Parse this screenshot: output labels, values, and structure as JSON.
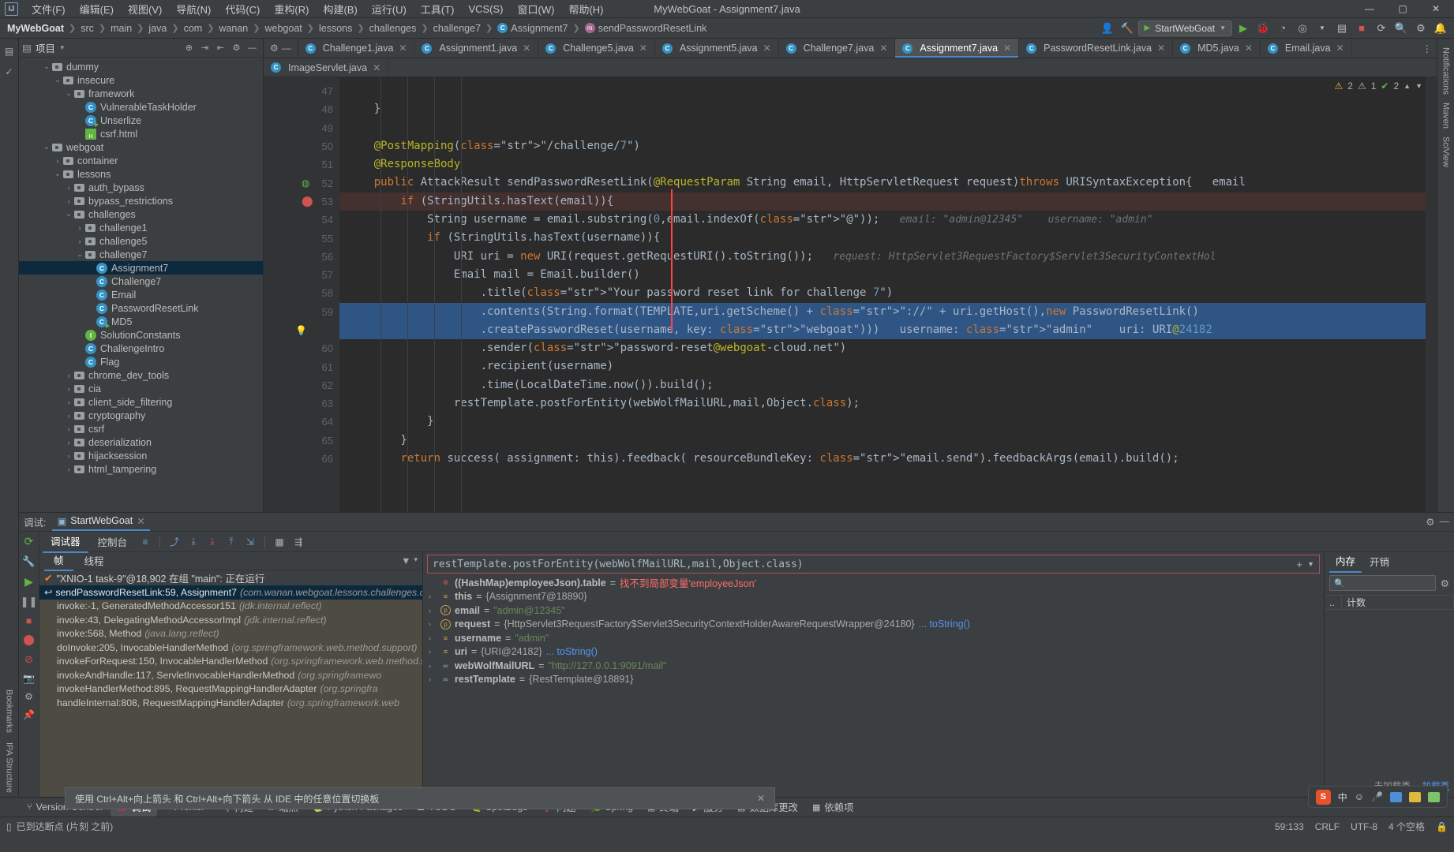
{
  "window": {
    "title": "MyWebGoat - Assignment7.java",
    "logo": "IJ",
    "minimize": "—",
    "maximize": "▢",
    "close": "✕"
  },
  "menu": [
    "文件(F)",
    "编辑(E)",
    "视图(V)",
    "导航(N)",
    "代码(C)",
    "重构(R)",
    "构建(B)",
    "运行(U)",
    "工具(T)",
    "VCS(S)",
    "窗口(W)",
    "帮助(H)"
  ],
  "breadcrumb": {
    "project": "MyWebGoat",
    "items": [
      "src",
      "main",
      "java",
      "com",
      "wanan",
      "webgoat",
      "lessons",
      "challenges",
      "challenge7"
    ],
    "class": "Assignment7",
    "method": "sendPasswordResetLink"
  },
  "nav_right": {
    "run_config": "StartWebGoat",
    "icons": [
      "user-icon",
      "hammer-icon",
      "run-icon",
      "debug-icon",
      "coverage-icon",
      "profile-icon",
      "stop-icon",
      "layout-icon",
      "search-icon",
      "settings-icon",
      "notifications-icon"
    ]
  },
  "project_panel": {
    "title": "项目",
    "tools": [
      "collapse-icon",
      "expand-icon",
      "settings-icon",
      "hide-icon"
    ],
    "tree": [
      {
        "label": "dummy",
        "depth": 3,
        "type": "folder",
        "arrow": "v"
      },
      {
        "label": "insecure",
        "depth": 4,
        "type": "folder",
        "arrow": "v"
      },
      {
        "label": "framework",
        "depth": 5,
        "type": "folder",
        "arrow": "v"
      },
      {
        "label": "VulnerableTaskHolder",
        "depth": 6,
        "type": "class",
        "arrow": ""
      },
      {
        "label": "Unserlize",
        "depth": 6,
        "type": "class-run",
        "arrow": ""
      },
      {
        "label": "csrf.html",
        "depth": 6,
        "type": "html",
        "arrow": ""
      },
      {
        "label": "webgoat",
        "depth": 3,
        "type": "folder",
        "arrow": "v"
      },
      {
        "label": "container",
        "depth": 4,
        "type": "folder",
        "arrow": ">"
      },
      {
        "label": "lessons",
        "depth": 4,
        "type": "folder",
        "arrow": "v"
      },
      {
        "label": "auth_bypass",
        "depth": 5,
        "type": "folder",
        "arrow": ">"
      },
      {
        "label": "bypass_restrictions",
        "depth": 5,
        "type": "folder",
        "arrow": ">"
      },
      {
        "label": "challenges",
        "depth": 5,
        "type": "folder",
        "arrow": "v"
      },
      {
        "label": "challenge1",
        "depth": 6,
        "type": "folder",
        "arrow": ">"
      },
      {
        "label": "challenge5",
        "depth": 6,
        "type": "folder",
        "arrow": ">"
      },
      {
        "label": "challenge7",
        "depth": 6,
        "type": "folder",
        "arrow": "v"
      },
      {
        "label": "Assignment7",
        "depth": 7,
        "type": "class",
        "arrow": "",
        "selected": true
      },
      {
        "label": "Challenge7",
        "depth": 7,
        "type": "class",
        "arrow": ""
      },
      {
        "label": "Email",
        "depth": 7,
        "type": "class",
        "arrow": ""
      },
      {
        "label": "PasswordResetLink",
        "depth": 7,
        "type": "class",
        "arrow": ""
      },
      {
        "label": "MD5",
        "depth": 7,
        "type": "class-run",
        "arrow": ""
      },
      {
        "label": "SolutionConstants",
        "depth": 6,
        "type": "interface",
        "arrow": ""
      },
      {
        "label": "ChallengeIntro",
        "depth": 6,
        "type": "class",
        "arrow": ""
      },
      {
        "label": "Flag",
        "depth": 6,
        "type": "class",
        "arrow": ""
      },
      {
        "label": "chrome_dev_tools",
        "depth": 5,
        "type": "folder",
        "arrow": ">"
      },
      {
        "label": "cia",
        "depth": 5,
        "type": "folder",
        "arrow": ">"
      },
      {
        "label": "client_side_filtering",
        "depth": 5,
        "type": "folder",
        "arrow": ">"
      },
      {
        "label": "cryptography",
        "depth": 5,
        "type": "folder",
        "arrow": ">"
      },
      {
        "label": "csrf",
        "depth": 5,
        "type": "folder",
        "arrow": ">"
      },
      {
        "label": "deserialization",
        "depth": 5,
        "type": "folder",
        "arrow": ">"
      },
      {
        "label": "hijacksession",
        "depth": 5,
        "type": "folder",
        "arrow": ">"
      },
      {
        "label": "html_tampering",
        "depth": 5,
        "type": "folder",
        "arrow": ">"
      }
    ]
  },
  "editor": {
    "tabs_row1": [
      {
        "label": "Challenge1.java",
        "active": false
      },
      {
        "label": "Assignment1.java",
        "active": false
      },
      {
        "label": "Challenge5.java",
        "active": false
      },
      {
        "label": "Assignment5.java",
        "active": false
      },
      {
        "label": "Challenge7.java",
        "active": false
      },
      {
        "label": "Assignment7.java",
        "active": true
      },
      {
        "label": "PasswordResetLink.java",
        "active": false
      },
      {
        "label": "MD5.java",
        "active": false,
        "run": true
      },
      {
        "label": "Email.java",
        "active": false
      }
    ],
    "tabs_row2": [
      {
        "label": "ImageServlet.java",
        "active": false
      }
    ],
    "inspection_badges": {
      "warnings": "2",
      "weak_warnings": "1",
      "checks": "2"
    },
    "first_line": 47,
    "lines": [
      {
        "n": 47,
        "text": ""
      },
      {
        "n": 48,
        "text": "    }"
      },
      {
        "n": 49,
        "text": ""
      },
      {
        "n": 50,
        "text": "    @PostMapping(\"/challenge/7\")"
      },
      {
        "n": 51,
        "text": "    @ResponseBody"
      },
      {
        "n": 52,
        "text": "    public AttackResult sendPasswordResetLink(@RequestParam String email, HttpServletRequest request)throws URISyntaxException{   email"
      },
      {
        "n": 53,
        "text": "        if (StringUtils.hasText(email)){",
        "breakpoint": true
      },
      {
        "n": 54,
        "text": "            String username = email.substring(0,email.indexOf(\"@\"));",
        "hint": "email: \"admin@12345\"    username: \"admin\""
      },
      {
        "n": 55,
        "text": "            if (StringUtils.hasText(username)){"
      },
      {
        "n": 56,
        "text": "                URI uri = new URI(request.getRequestURI().toString());",
        "hint": "request: HttpServlet3RequestFactory$Servlet3SecurityContextHol"
      },
      {
        "n": 57,
        "text": "                Email mail = Email.builder()"
      },
      {
        "n": 58,
        "text": "                    .title(\"Your password reset link for challenge 7\")"
      },
      {
        "n": 59,
        "text": "                    .contents(String.format(TEMPLATE,uri.getScheme() + \"://\" + uri.getHost(),new PasswordResetLink()",
        "current": true
      },
      {
        "n": 59,
        "text": "                    .createPasswordReset(username, key: \"webgoat\")))   username: \"admin\"    uri: URI@24182",
        "current": true,
        "cont": true
      },
      {
        "n": 60,
        "text": "                    .sender(\"password-reset@webgoat-cloud.net\")"
      },
      {
        "n": 61,
        "text": "                    .recipient(username)"
      },
      {
        "n": 62,
        "text": "                    .time(LocalDateTime.now()).build();"
      },
      {
        "n": 63,
        "text": "                restTemplate.postForEntity(webWolfMailURL,mail,Object.class);"
      },
      {
        "n": 64,
        "text": "            }"
      },
      {
        "n": 65,
        "text": "        }"
      },
      {
        "n": 66,
        "text": "        return success( assignment: this).feedback( resourceBundleKey: \"email.send\").feedbackArgs(email).build();"
      }
    ]
  },
  "debug": {
    "label": "调试:",
    "session_tab": "StartWebGoat",
    "tabs": [
      "调试器",
      "控制台"
    ],
    "toolbar_icons": [
      "layout-icon",
      "step-over-icon",
      "step-into-icon",
      "force-step-into-icon",
      "step-out-icon",
      "run-to-cursor-icon",
      "evaluate-icon",
      "mute-breakpoints-icon"
    ],
    "rail_icons": [
      "rerun-icon",
      "settings-icon",
      "resume-icon",
      "pause-icon",
      "stop-icon",
      "view-breakpoints-icon",
      "mute-breakpoints-icon",
      "camera-icon",
      "gear-icon",
      "pin-icon"
    ],
    "frames": {
      "tabs": [
        "帧",
        "线程"
      ],
      "thread": "\"XNIO-1 task-9\"@18,902 在组 \"main\": 正在运行",
      "items": [
        {
          "name": "sendPasswordResetLink:59, Assignment7",
          "pkg": "(com.wanan.webgoat.lessons.challenges.challe",
          "selected": true
        },
        {
          "name": "invoke:-1, GeneratedMethodAccessor151",
          "pkg": "(jdk.internal.reflect)"
        },
        {
          "name": "invoke:43, DelegatingMethodAccessorImpl",
          "pkg": "(jdk.internal.reflect)"
        },
        {
          "name": "invoke:568, Method",
          "pkg": "(java.lang.reflect)"
        },
        {
          "name": "doInvoke:205, InvocableHandlerMethod",
          "pkg": "(org.springframework.web.method.support)"
        },
        {
          "name": "invokeForRequest:150, InvocableHandlerMethod",
          "pkg": "(org.springframework.web.method.sup"
        },
        {
          "name": "invokeAndHandle:117, ServletInvocableHandlerMethod",
          "pkg": "(org.springframewo"
        },
        {
          "name": "invokeHandlerMethod:895, RequestMappingHandlerAdapter",
          "pkg": "(org.springfra"
        },
        {
          "name": "handleInternal:808, RequestMappingHandlerAdapter",
          "pkg": "(org.springframework.web"
        }
      ]
    },
    "watch": "restTemplate.postForEntity(webWolfMailURL,mail,Object.class)",
    "variables": [
      {
        "kind": "error",
        "name": "((HashMap)employeeJson).table",
        "value": "找不到局部变量'employeeJson'"
      },
      {
        "kind": "local",
        "name": "this",
        "value": "{Assignment7@18890}"
      },
      {
        "kind": "param",
        "name": "email",
        "value": "\"admin@12345\"",
        "string": true
      },
      {
        "kind": "param",
        "name": "request",
        "value": "{HttpServlet3RequestFactory$Servlet3SecurityContextHolderAwareRequestWrapper@24180}",
        "link": "... toString()"
      },
      {
        "kind": "local",
        "name": "username",
        "value": "\"admin\"",
        "string": true
      },
      {
        "kind": "local",
        "name": "uri",
        "value": "{URI@24182}",
        "link": "... toString()"
      },
      {
        "kind": "field",
        "name": "webWolfMailURL",
        "value": "\"http://127.0.0.1:9091/mail\"",
        "string": true
      },
      {
        "kind": "field",
        "name": "restTemplate",
        "value": "{RestTemplate@18891}"
      }
    ],
    "memory": {
      "tabs": [
        "内存",
        "开销"
      ],
      "search_placeholder": "",
      "columns": [
        "..",
        "计数",
        ""
      ],
      "note_text": "未加载类。",
      "note_link": "加载类"
    }
  },
  "tooltip": {
    "text": "使用 Ctrl+Alt+向上箭头 和 Ctrl+Alt+向下箭头 从 IDE 中的任意位置切换板",
    "close": "✕"
  },
  "tool_windows": [
    {
      "label": "Version Control",
      "icon": "branch-icon",
      "active": false
    },
    {
      "label": "调试",
      "icon": "debug-icon",
      "active": true
    },
    {
      "label": "Profiler",
      "icon": "profiler-icon",
      "active": false
    },
    {
      "label": "构建",
      "icon": "build-icon",
      "active": false
    },
    {
      "label": "端点",
      "icon": "endpoints-icon",
      "active": false
    },
    {
      "label": "Python Packages",
      "icon": "python-icon",
      "active": false
    },
    {
      "label": "TODO",
      "icon": "todo-icon",
      "active": false
    },
    {
      "label": "SpotBugs",
      "icon": "bug-icon",
      "active": false
    },
    {
      "label": "问题",
      "icon": "problems-icon",
      "active": false
    },
    {
      "label": "Spring",
      "icon": "spring-icon",
      "active": false
    },
    {
      "label": "终端",
      "icon": "terminal-icon",
      "active": false
    },
    {
      "label": "服务",
      "icon": "services-icon",
      "active": false
    },
    {
      "label": "数据库更改",
      "icon": "db-icon",
      "active": false
    },
    {
      "label": "依赖项",
      "icon": "deps-icon",
      "active": false
    }
  ],
  "status_bar": {
    "message": "已到达断点 (片刻 之前)",
    "position": "59:133",
    "line_sep": "CRLF",
    "encoding": "UTF-8",
    "indent": "4 个空格"
  },
  "left_rail": {
    "labels": [
      "Bookmarks",
      "IPA Structure"
    ],
    "icons": [
      "project-icon",
      "commit-icon",
      "structure-icon",
      "bookmarks-icon"
    ]
  },
  "right_rail": {
    "labels": [
      "Notifications",
      "Maven",
      "SciView"
    ]
  },
  "ime": {
    "app": "S",
    "mode": "中",
    "tools": [
      "emoji-icon",
      "mic-icon",
      "keyboard-icon",
      "clipboard-icon",
      "grid-icon"
    ]
  }
}
